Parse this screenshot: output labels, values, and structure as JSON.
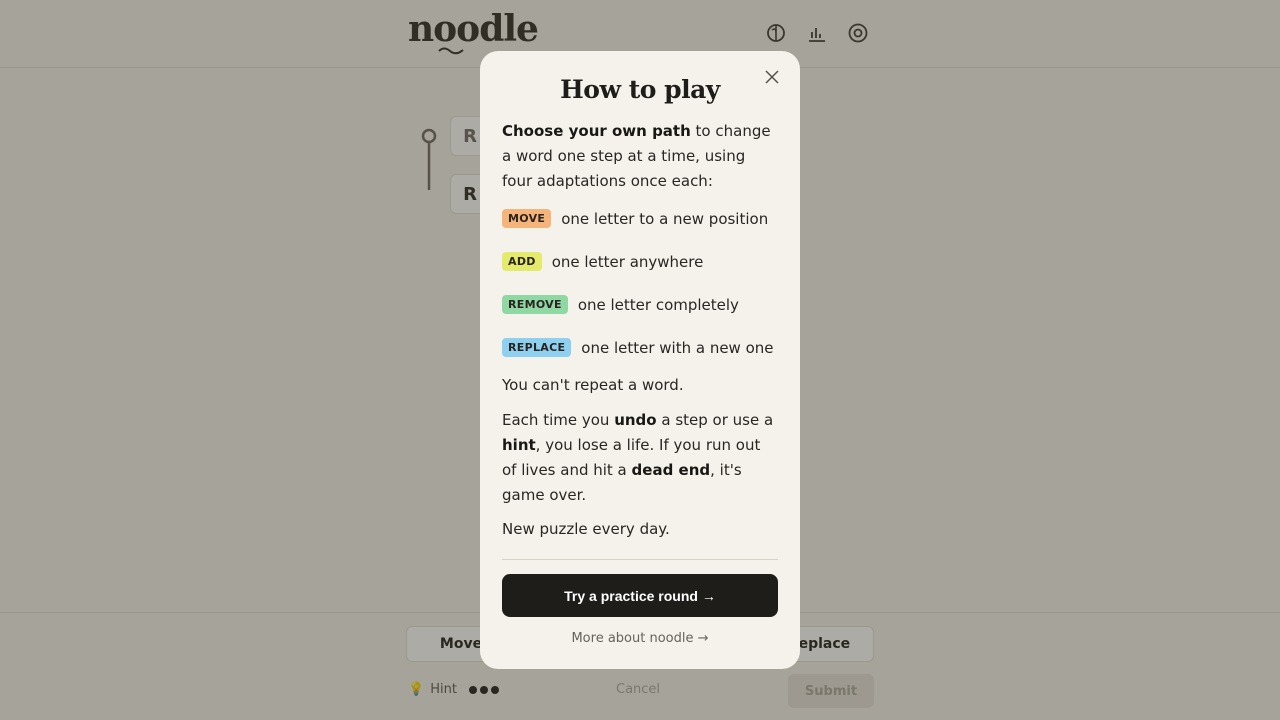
{
  "app": {
    "logo": "noodle",
    "top_icons": [
      "help-icon",
      "stats-icon",
      "settings-icon"
    ],
    "tiles": [
      "R",
      "R"
    ],
    "actions": [
      "Move",
      "Replace"
    ],
    "hint_label": "Hint",
    "cancel_label": "Cancel",
    "submit_label": "Submit"
  },
  "modal": {
    "title": "How to play",
    "intro_bold": "Choose your own path",
    "intro_rest": " to change a word one step at a time, using four adaptations once each:",
    "rules": [
      {
        "tag": "MOVE",
        "text": "one letter to a new position",
        "color": "#f4b47a"
      },
      {
        "tag": "ADD",
        "text": "one letter anywhere",
        "color": "#e4ea6c"
      },
      {
        "tag": "REMOVE",
        "text": "one letter completely",
        "color": "#8fd7a3"
      },
      {
        "tag": "REPLACE",
        "text": "one letter with a new one",
        "color": "#8dd0ef"
      }
    ],
    "repeat": "You can't repeat a word.",
    "undo_parts": [
      "Each time you ",
      "undo",
      " a step or use a ",
      "hint",
      ", you lose a life. If you run out of lives and hit a ",
      "dead end",
      ", it's game over."
    ],
    "daily": "New puzzle every day.",
    "primary_button": "Try a practice round →",
    "more_link": "More about noodle →"
  }
}
